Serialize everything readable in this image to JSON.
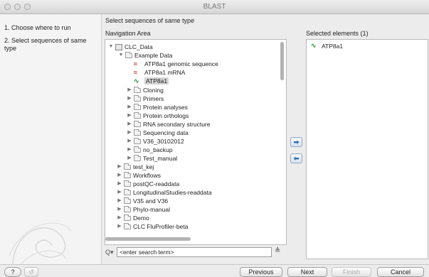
{
  "window": {
    "title": "BLAST"
  },
  "steps": [
    {
      "label": "1. Choose where to run"
    },
    {
      "label": "2. Select sequences of same type"
    }
  ],
  "header": {
    "instruction": "Select sequences of same type",
    "navigation_title": "Navigation Area",
    "selected_title": "Selected elements (1)"
  },
  "tree": [
    {
      "label": "CLC_Data",
      "type": "db",
      "state": "expanded"
    },
    {
      "label": "Example Data",
      "type": "folder",
      "state": "expanded"
    },
    {
      "label": "ATP8a1 genomic sequence",
      "type": "sequence-red",
      "state": ""
    },
    {
      "label": "ATP8a1 mRNA",
      "type": "sequence-red",
      "state": ""
    },
    {
      "label": "ATP8a1",
      "type": "sequence-green",
      "state": "selected"
    },
    {
      "label": "Cloning",
      "type": "folder",
      "state": "collapsed"
    },
    {
      "label": "Primers",
      "type": "folder",
      "state": "collapsed"
    },
    {
      "label": "Protein analyses",
      "type": "folder",
      "state": "collapsed"
    },
    {
      "label": "Protein orthologs",
      "type": "folder",
      "state": "collapsed"
    },
    {
      "label": "RNA secondary structure",
      "type": "folder",
      "state": "collapsed"
    },
    {
      "label": "Sequencing data",
      "type": "folder",
      "state": "collapsed"
    },
    {
      "label": "V36_30102012",
      "type": "folder",
      "state": "collapsed"
    },
    {
      "label": "no_backup",
      "type": "folder",
      "state": "collapsed"
    },
    {
      "label": "Test_manual",
      "type": "folder",
      "state": "collapsed"
    },
    {
      "label": "test_kej",
      "type": "folder",
      "state": "collapsed"
    },
    {
      "label": "Workflows",
      "type": "folder",
      "state": "collapsed"
    },
    {
      "label": "postQC-readdata",
      "type": "folder",
      "state": "collapsed"
    },
    {
      "label": "LongitudinalStudies-readdata",
      "type": "folder",
      "state": "collapsed"
    },
    {
      "label": "V35 and V36",
      "type": "folder",
      "state": "collapsed"
    },
    {
      "label": "Phylo-manual",
      "type": "folder",
      "state": "collapsed"
    },
    {
      "label": "Demo",
      "type": "folder",
      "state": "collapsed"
    },
    {
      "label": "CLC FluProfiler-beta",
      "type": "folder",
      "state": "collapsed"
    }
  ],
  "search": {
    "placeholder": "<enter search term>"
  },
  "selected": [
    {
      "label": "ATP8a1",
      "type": "sequence-green"
    }
  ],
  "buttons": {
    "help": "?",
    "previous": "Previous",
    "next": "Next",
    "finish": "Finish",
    "cancel": "Cancel"
  },
  "icons": {
    "add": "arrow-right-icon",
    "remove": "arrow-left-icon"
  }
}
